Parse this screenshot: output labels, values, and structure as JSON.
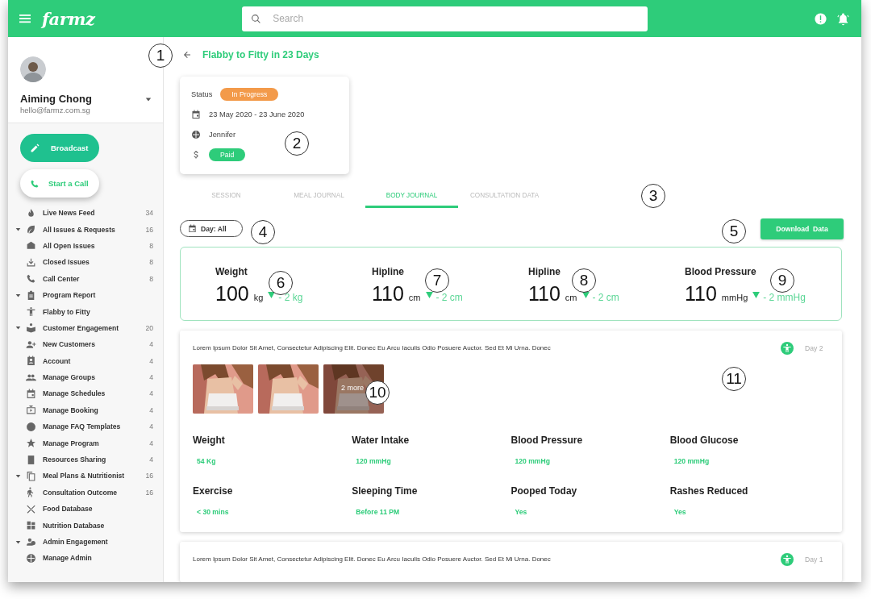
{
  "topbar": {
    "logo": "farmz",
    "search": {
      "placeholder": "Search"
    }
  },
  "profile": {
    "name": "Aiming Chong",
    "email": "hello@farmz.com.sg"
  },
  "actions": [
    {
      "label": "Broadcast",
      "kind": "primary"
    },
    {
      "label": "Start a Call",
      "kind": "secondary"
    }
  ],
  "nav": [
    {
      "label": "Live News Feed",
      "count": "34"
    },
    {
      "label": "All Issues & Requests",
      "count": "16",
      "expanded": true,
      "children": [
        {
          "label": "All Open Issues",
          "count": "8"
        },
        {
          "label": "Closed Issues",
          "count": "8"
        },
        {
          "label": "Call Center",
          "count": "8"
        }
      ]
    },
    {
      "label": "Program Report",
      "expanded": true,
      "children": [
        {
          "label": "Flabby to Fitty"
        }
      ]
    },
    {
      "label": "Customer Engagement",
      "count": "20",
      "expanded": true,
      "children": [
        {
          "label": "New Customers",
          "count": "4"
        },
        {
          "label": "Account",
          "count": "4"
        },
        {
          "label": "Manage Groups",
          "count": "4"
        },
        {
          "label": "Manage Schedules",
          "count": "4"
        },
        {
          "label": "Manage Booking",
          "count": "4"
        },
        {
          "label": "Manage FAQ Templates",
          "count": "4"
        },
        {
          "label": "Manage Program",
          "count": "4"
        },
        {
          "label": "Resources Sharing",
          "count": "4"
        }
      ]
    },
    {
      "label": "Meal Plans & Nutritionist",
      "count": "16",
      "expanded": true,
      "children": [
        {
          "label": "Consultation Outcome",
          "count": "16"
        },
        {
          "label": "Food Database"
        },
        {
          "label": "Nutrition Database"
        }
      ]
    },
    {
      "label": "Admin Engagement",
      "expanded": true,
      "children": [
        {
          "label": "Manage Admin"
        }
      ]
    }
  ],
  "page": {
    "title": "Flabby to Fitty in 23 Days"
  },
  "info": {
    "status_label": "Status",
    "status": "In Progress",
    "dates": "23 May 2020 - 23 June 2020",
    "coach": "Jennifer",
    "payment": "Paid"
  },
  "tabs": [
    {
      "label": "SESSION",
      "selected": false
    },
    {
      "label": "MEAL JOURNAL",
      "selected": false
    },
    {
      "label": "BODY JOURNAL",
      "selected": true
    },
    {
      "label": "CONSULTATION DATA",
      "selected": false
    }
  ],
  "filter": {
    "label": "Day: All"
  },
  "download": {
    "label": "Download  Data"
  },
  "metrics": [
    {
      "label": "Weight",
      "value": "100",
      "unit": "kg",
      "delta": "- 2 kg"
    },
    {
      "label": "Hipline",
      "value": "110",
      "unit": "cm",
      "delta": "- 2 cm"
    },
    {
      "label": "Hipline",
      "value": "110",
      "unit": "cm",
      "delta": "- 2 cm"
    },
    {
      "label": "Blood Pressure",
      "value": "110",
      "unit": "mmHg",
      "delta": "- 2 mmHg"
    }
  ],
  "entries": [
    {
      "text": "Lorem Ipsum Dolor Sit Amet, Consectetur Adipiscing Elit. Donec Eu Arcu Iaculis Odio Posuere Auctor. Sed Et Mi Urna. Donec",
      "day": "Day 2",
      "photos": [
        {
          "kind": "picture"
        },
        {
          "kind": "picture"
        },
        {
          "kind": "picture",
          "more": "2 more"
        }
      ],
      "fields": [
        {
          "label": "Weight",
          "value": "54 Kg"
        },
        {
          "label": "Water Intake",
          "value": "120 mmHg"
        },
        {
          "label": "Blood Pressure",
          "value": "120 mmHg"
        },
        {
          "label": "Blood Glucose",
          "value": "120 mmHg"
        },
        {
          "label": "Exercise",
          "value": "< 30 mins"
        },
        {
          "label": "Sleeping Time",
          "value": "Before 11 PM"
        },
        {
          "label": "Pooped Today",
          "value": "Yes"
        },
        {
          "label": "Rashes Reduced",
          "value": "Yes"
        }
      ]
    },
    {
      "text": "Lorem Ipsum Dolor Sit Amet, Consectetur Adipiscing Elit. Donec Eu Arcu Iaculis Odio Posuere Auctor. Sed Et Mi Urna. Donec",
      "day": "Day 1"
    }
  ],
  "callouts": [
    "1",
    "2",
    "3",
    "4",
    "5",
    "6",
    "7",
    "8",
    "9",
    "10",
    "11"
  ]
}
